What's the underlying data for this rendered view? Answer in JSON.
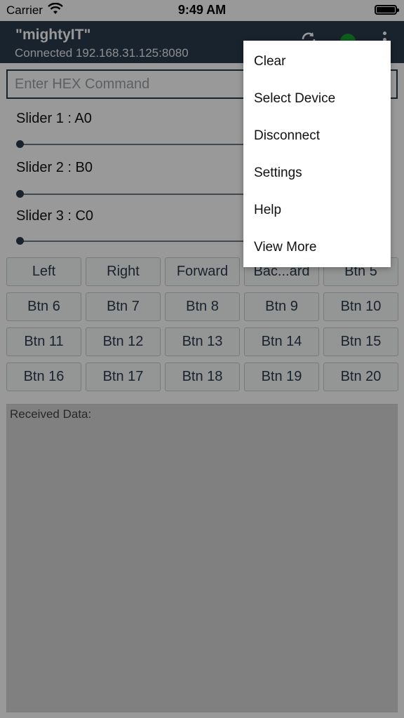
{
  "status_bar": {
    "carrier": "Carrier",
    "time": "9:49 AM"
  },
  "nav": {
    "title": "\"mightyIT\"",
    "subtitle": "Connected 192.168.31.125:8080",
    "status_color": "#1a9b2e"
  },
  "input": {
    "placeholder": "Enter HEX Command",
    "value": ""
  },
  "sliders": [
    {
      "label": "Slider 1 : A0",
      "value": 0
    },
    {
      "label": "Slider 2 : B0",
      "value": 0
    },
    {
      "label": "Slider 3 : C0",
      "value": 0
    }
  ],
  "buttons": [
    "Left",
    "Right",
    "Forward",
    "Bac...ard",
    "Btn 5",
    "Btn 6",
    "Btn 7",
    "Btn 8",
    "Btn 9",
    "Btn 10",
    "Btn 11",
    "Btn 12",
    "Btn 13",
    "Btn 14",
    "Btn 15",
    "Btn 16",
    "Btn 17",
    "Btn 18",
    "Btn 19",
    "Btn 20"
  ],
  "received": {
    "label": "Received Data:"
  },
  "menu": {
    "items": [
      "Clear",
      "Select Device",
      "Disconnect",
      "Settings",
      "Help",
      "View More"
    ]
  },
  "colors": {
    "nav_bg": "#2b3b4d",
    "accent": "#2b3b4d"
  }
}
